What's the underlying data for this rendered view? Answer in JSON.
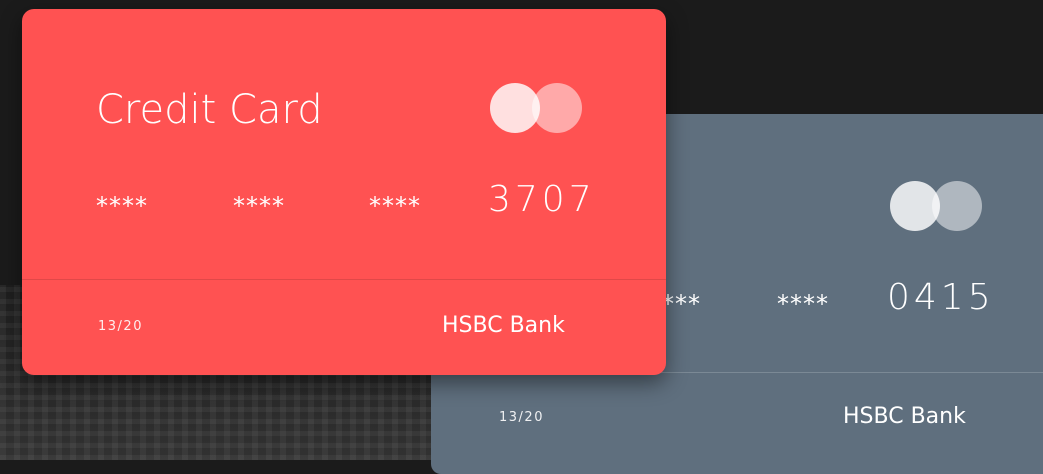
{
  "cards": [
    {
      "title": "Credit Card",
      "number_groups": [
        "****",
        "****",
        "****"
      ],
      "last4": "3707",
      "expiry": "13/20",
      "bank": "HSBC Bank",
      "logo_icon": "card-network-logo-icon",
      "color": "#ff5252"
    },
    {
      "number_groups": [
        "****",
        "****"
      ],
      "last4": "0415",
      "expiry": "13/20",
      "bank": "HSBC Bank",
      "logo_icon": "card-network-logo-icon",
      "color": "#5f6f7e"
    }
  ]
}
